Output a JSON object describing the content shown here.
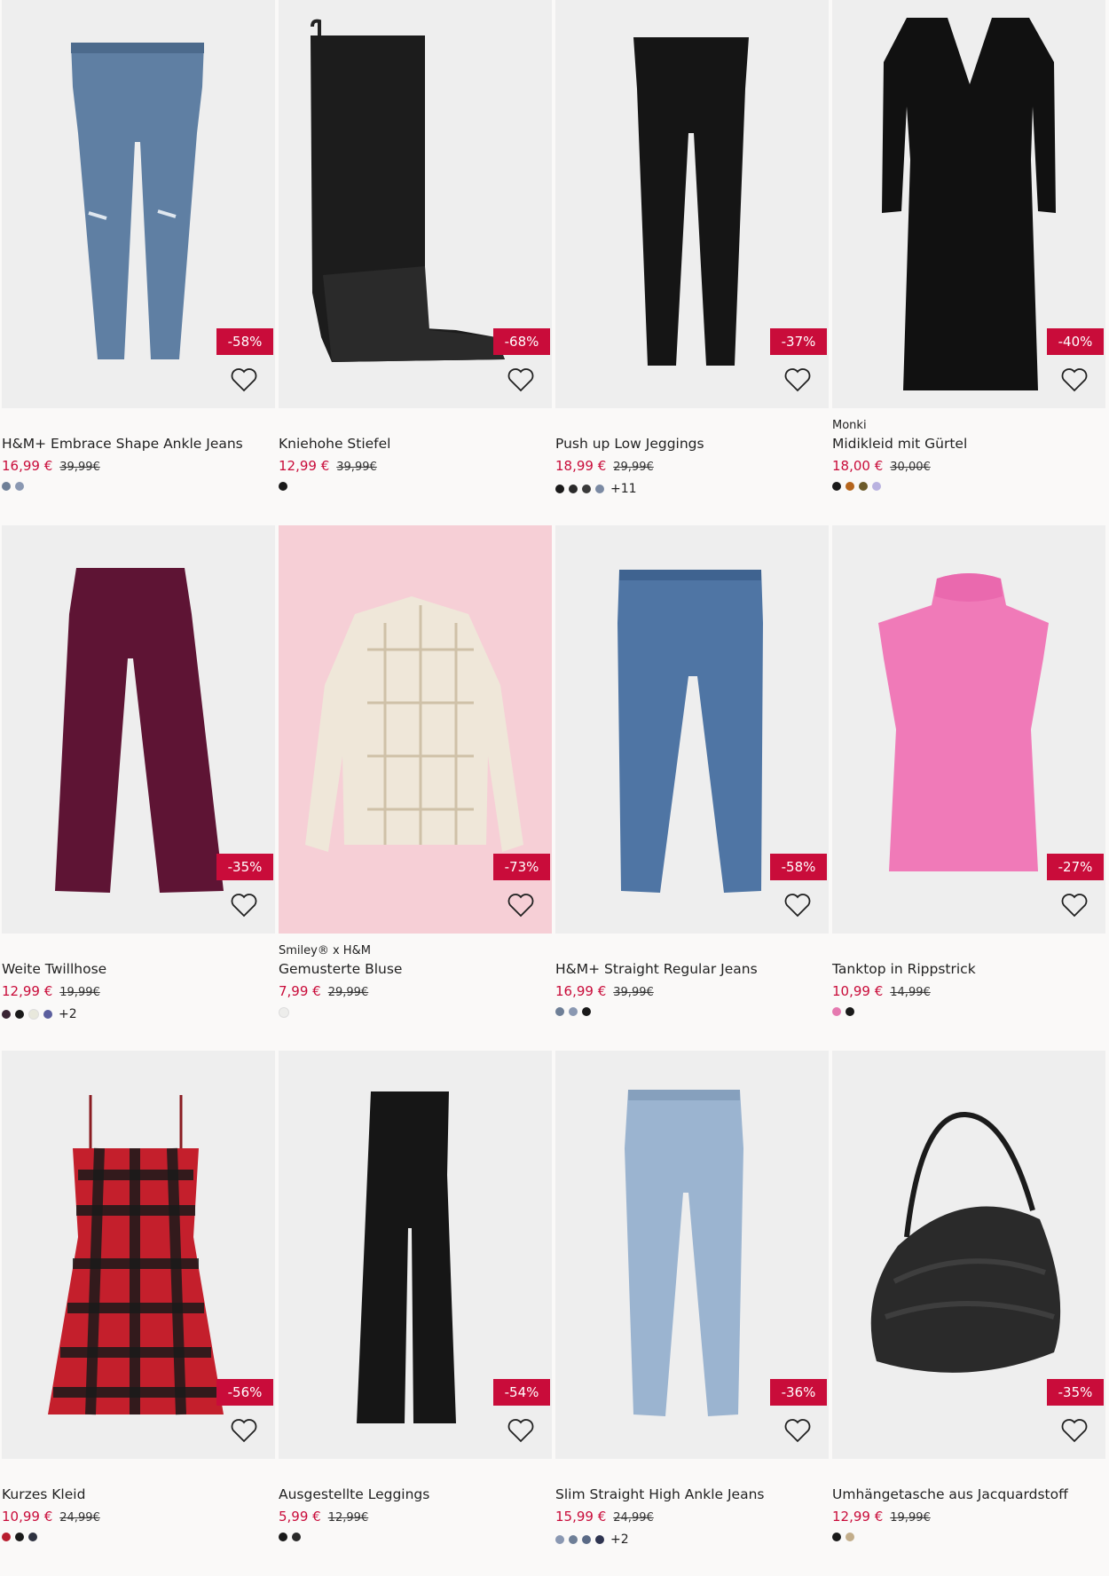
{
  "products": [
    {
      "brand": "",
      "title": "H&M+ Embrace Shape Ankle Jeans",
      "price": "16,99 €",
      "old_price": "39,99€",
      "discount": "-58%",
      "swatches": [
        "#6e7f97",
        "#8a98b2"
      ],
      "more": "",
      "image": "light-wash-skinny-jeans"
    },
    {
      "brand": "",
      "title": "Kniehohe Stiefel",
      "price": "12,99 €",
      "old_price": "39,99€",
      "discount": "-68%",
      "swatches": [
        "#1a1a1a"
      ],
      "more": "",
      "image": "black-knee-high-boot"
    },
    {
      "brand": "",
      "title": "Push up Low Jeggings",
      "price": "18,99 €",
      "old_price": "29,99€",
      "discount": "-37%",
      "swatches": [
        "#1a1a1a",
        "#2a2a2a",
        "#3a3a3a",
        "#7b8aa3"
      ],
      "more": "+11",
      "image": "black-jeggings"
    },
    {
      "brand": "Monki",
      "title": "Midikleid mit Gürtel",
      "price": "18,00 €",
      "old_price": "30,00€",
      "discount": "-40%",
      "swatches": [
        "#1a1a1a",
        "#b5651d",
        "#6b5a2a",
        "#b9b2e0"
      ],
      "more": "",
      "image": "black-midi-dress"
    },
    {
      "brand": "",
      "title": "Weite Twillhose",
      "price": "12,99 €",
      "old_price": "19,99€",
      "discount": "-35%",
      "swatches": [
        "#3a2434",
        "#1a1a1a",
        "#e8e8dc",
        "#5b5f9e"
      ],
      "more": "+2",
      "image": "burgundy-wide-trousers"
    },
    {
      "brand": "Smiley® x H&M",
      "title": "Gemusterte Bluse",
      "price": "7,99 €",
      "old_price": "29,99€",
      "discount": "-73%",
      "swatches": [
        "#ededeb"
      ],
      "more": "",
      "image": "patterned-blouse"
    },
    {
      "brand": "",
      "title": "H&M+ Straight Regular Jeans",
      "price": "16,99 €",
      "old_price": "39,99€",
      "discount": "-58%",
      "swatches": [
        "#6e7f97",
        "#8a98b2",
        "#1a1a1a"
      ],
      "more": "",
      "image": "mid-wash-straight-jeans"
    },
    {
      "brand": "",
      "title": "Tanktop in Rippstrick",
      "price": "10,99 €",
      "old_price": "14,99€",
      "discount": "-27%",
      "swatches": [
        "#e57ab0",
        "#1a1a1a"
      ],
      "more": "",
      "image": "pink-rib-tank-top"
    },
    {
      "brand": "",
      "title": "Kurzes Kleid",
      "price": "10,99 €",
      "old_price": "24,99€",
      "discount": "-56%",
      "swatches": [
        "#b81d2e",
        "#1a1a1a",
        "#2e3240"
      ],
      "more": "",
      "image": "red-plaid-dress"
    },
    {
      "brand": "",
      "title": "Ausgestellte Leggings",
      "price": "5,99 €",
      "old_price": "12,99€",
      "discount": "-54%",
      "swatches": [
        "#1a1a1a",
        "#2a2a2a"
      ],
      "more": "",
      "image": "black-flared-leggings"
    },
    {
      "brand": "",
      "title": "Slim Straight High Ankle Jeans",
      "price": "15,99 €",
      "old_price": "24,99€",
      "discount": "-36%",
      "swatches": [
        "#8a98b2",
        "#6e7f97",
        "#5a6a86",
        "#2e3450"
      ],
      "more": "+2",
      "image": "light-blue-high-jeans"
    },
    {
      "brand": "",
      "title": "Umhängetasche aus Jacquardstoff",
      "price": "12,99 €",
      "old_price": "19,99€",
      "discount": "-35%",
      "swatches": [
        "#1a1a1a",
        "#c2ad8a"
      ],
      "more": "",
      "image": "black-jacquard-shoulder-bag"
    }
  ]
}
